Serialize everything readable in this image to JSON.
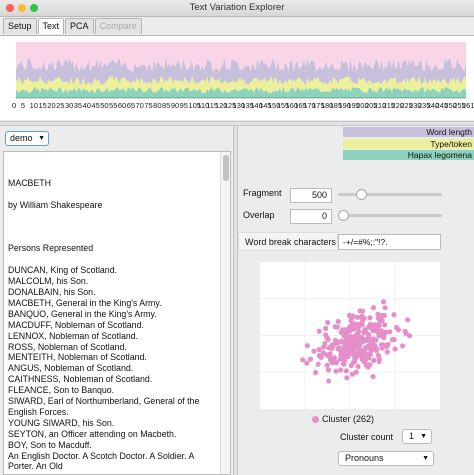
{
  "window": {
    "title": "Text Variation Explorer"
  },
  "tabs": [
    {
      "label": "Setup"
    },
    {
      "label": "Text"
    },
    {
      "label": "PCA"
    },
    {
      "label": "Compare"
    }
  ],
  "area_chart": {
    "x_ticks": [
      "0",
      "5",
      "10",
      "15",
      "20",
      "25",
      "30",
      "35",
      "40",
      "45",
      "50",
      "55",
      "60",
      "65",
      "70",
      "75",
      "80",
      "85",
      "90",
      "95",
      "105",
      "110",
      "115",
      "120",
      "125",
      "130",
      "135",
      "140",
      "145",
      "150",
      "155",
      "160",
      "165",
      "170",
      "175",
      "180",
      "185",
      "190",
      "195",
      "200",
      "205",
      "210",
      "215",
      "220",
      "225",
      "230",
      "235",
      "240",
      "245",
      "250",
      "255",
      "261"
    ],
    "series": [
      {
        "name": "Word length",
        "color": "#c6c0dd"
      },
      {
        "name": "Type/token",
        "color": "#ecf09a"
      },
      {
        "name": "Hapax legomena",
        "color": "#8cd3bd"
      }
    ],
    "background_color": "#f8d6e8"
  },
  "text_panel": {
    "selector_value": "demo",
    "lines": [
      "MACBETH",
      "",
      "by William Shakespeare",
      "",
      "",
      "",
      "Persons Represented",
      "",
      "DUNCAN, King of Scotland.",
      "MALCOLM, his Son.",
      "DONALBAIN, his Son.",
      "MACBETH, General in the King's Army.",
      "BANQUO, General in the King's Army.",
      "MACDUFF, Nobleman of Scotland.",
      "LENNOX, Nobleman of Scotland.",
      "ROSS, Nobleman of Scotland.",
      "MENTEITH, Nobleman of Scotland.",
      "ANGUS, Nobleman of Scotland.",
      "CAITHNESS, Nobleman of Scotland.",
      "FLEANCE, Son to Banquo.",
      "SIWARD, Earl of Northumberland, General of the",
      "English Forces.",
      "YOUNG SIWARD, his Son.",
      "SEYTON, an Officer attending on Macbeth.",
      "BOY, Son to Macduff.",
      "An English Doctor. A Scotch Doctor. A Soldier. A",
      "Porter. An Old"
    ]
  },
  "controls": {
    "fragment_label": "Fragment",
    "fragment_value": "500",
    "fragment_slider_level": 0.22,
    "overlap_label": "Overlap",
    "overlap_value": "0",
    "overlap_slider_level": 0.0,
    "word_break_label": "Word break characters",
    "word_break_value": "-+/=#%;:\"!?."
  },
  "scatter": {
    "point_color": "#e58ec9",
    "legend_label": "Cluster (262)",
    "cluster_count_label": "Cluster count",
    "cluster_count_value": "1",
    "feature_value": "Pronouns"
  }
}
